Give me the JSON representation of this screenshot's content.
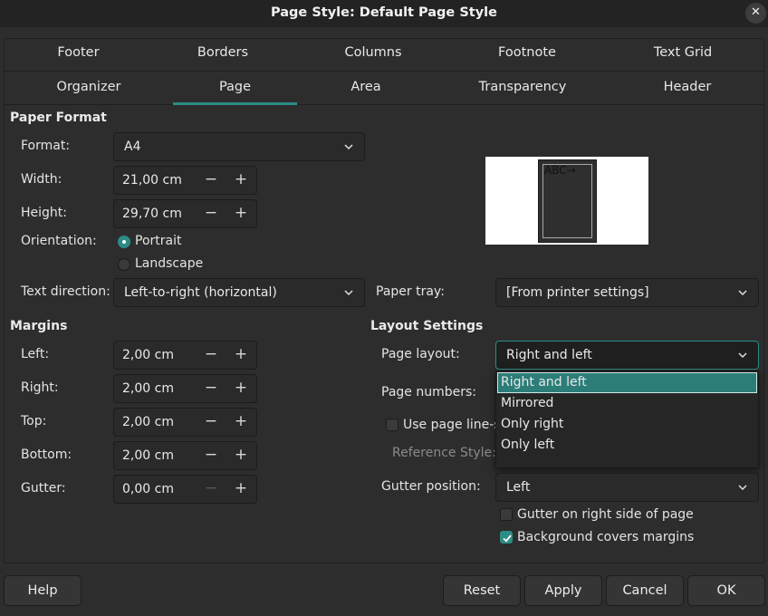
{
  "window": {
    "title": "Page Style: Default Page Style",
    "close_icon": "close-icon"
  },
  "tabs": {
    "row1": [
      "Footer",
      "Borders",
      "Columns",
      "Footnote",
      "Text Grid"
    ],
    "row2": [
      "Organizer",
      "Page",
      "Area",
      "Transparency",
      "Header"
    ],
    "active": "Page"
  },
  "paper_format": {
    "title": "Paper Format",
    "format_label": "Format:",
    "format_value": "A4",
    "width_label": "Width:",
    "width_value": "21,00 cm",
    "height_label": "Height:",
    "height_value": "29,70 cm",
    "orientation_label": "Orientation:",
    "portrait_label": "Portrait",
    "landscape_label": "Landscape",
    "orientation_selected": "Portrait",
    "text_direction_label": "Text direction:",
    "text_direction_value": "Left-to-right (horizontal)",
    "paper_tray_label": "Paper tray:",
    "paper_tray_value": "[From printer settings]",
    "preview_text": "ABC→"
  },
  "margins": {
    "title": "Margins",
    "left_label": "Left:",
    "left_value": "2,00 cm",
    "right_label": "Right:",
    "right_value": "2,00 cm",
    "top_label": "Top:",
    "top_value": "2,00 cm",
    "bottom_label": "Bottom:",
    "bottom_value": "2,00 cm",
    "gutter_label": "Gutter:",
    "gutter_value": "0,00 cm",
    "minus": "−",
    "plus": "+"
  },
  "layout": {
    "title": "Layout Settings",
    "page_layout_label": "Page layout:",
    "page_layout_value": "Right and left",
    "page_numbers_label": "Page numbers:",
    "use_line_spacing_label": "Use page line-sp",
    "reference_style_label": "Reference Style:",
    "gutter_position_label": "Gutter position:",
    "gutter_position_value": "Left",
    "gutter_right_label": "Gutter on right side of page",
    "gutter_right_checked": false,
    "background_covers_label": "Background covers margins",
    "background_covers_checked": true,
    "dropdown_options": [
      "Right and left",
      "Mirrored",
      "Only right",
      "Only left"
    ],
    "dropdown_selected": "Right and left"
  },
  "buttons": {
    "help": "Help",
    "reset": "Reset",
    "apply": "Apply",
    "cancel": "Cancel",
    "ok": "OK"
  },
  "colors": {
    "accent": "#2c8c86",
    "background": "#2d2d2d",
    "titlebar": "#232323"
  }
}
